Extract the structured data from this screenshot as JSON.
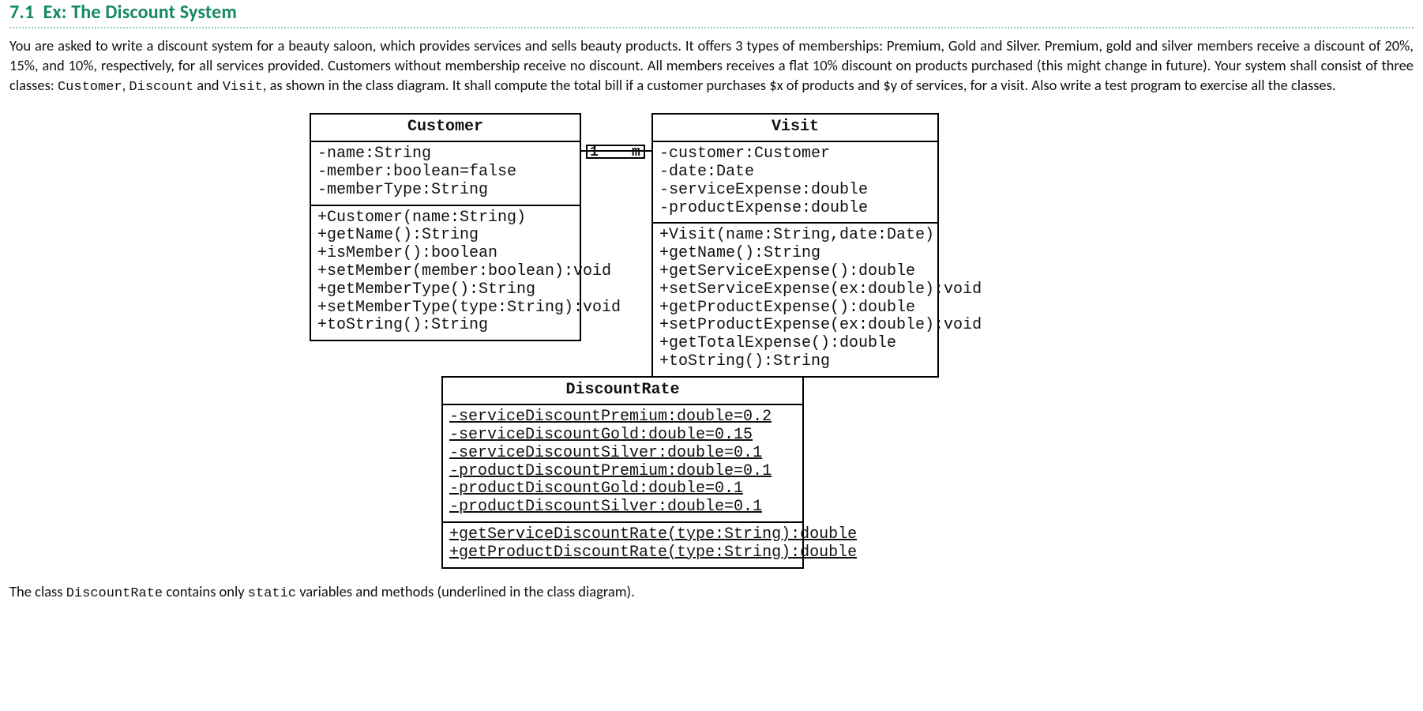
{
  "section": {
    "num": "7.1",
    "prefix": "Ex:",
    "title": "The Discount System"
  },
  "body": {
    "p1a": "You are asked to write a discount system for a beauty saloon, which provides services and sells beauty products. It offers 3 types of memberships: Premium, Gold and Silver. Premium, gold and silver members receive a discount of 20%, 15%, and 10%, respectively, for all services provided. Customers without membership receive no discount. All members receives a flat 10% discount on products purchased (this might change in future). Your system shall consist of three classes: ",
    "code1": "Customer",
    "sep1": ", ",
    "code2": "Discount",
    "mid": " and ",
    "code3": "Visit",
    "p1b": ", as shown in the class diagram. It shall compute the total bill if a customer purchases $x of products and $y of services, for a visit. Also write a test program to exercise all the classes."
  },
  "assoc": {
    "left": "1",
    "right": "m"
  },
  "classes": {
    "customer": {
      "name": "Customer",
      "attrs": [
        "-name:String",
        "-member:boolean=false",
        "-memberType:String"
      ],
      "ops": [
        "+Customer(name:String)",
        "+getName():String",
        "+isMember():boolean",
        "+setMember(member:boolean):void",
        "+getMemberType():String",
        "+setMemberType(type:String):void",
        "+toString():String"
      ]
    },
    "visit": {
      "name": "Visit",
      "attrs": [
        "-customer:Customer",
        "-date:Date",
        "-serviceExpense:double",
        "-productExpense:double"
      ],
      "ops": [
        "+Visit(name:String,date:Date)",
        "+getName():String",
        "+getServiceExpense():double",
        "+setServiceExpense(ex:double):void",
        "+getProductExpense():double",
        "+setProductExpense(ex:double):void",
        "+getTotalExpense():double",
        "+toString():String"
      ]
    },
    "discount": {
      "name": "DiscountRate",
      "attrs": [
        {
          "t": "-serviceDiscountPremium:double=0.2",
          "s": true
        },
        {
          "t": "-serviceDiscountGold:double=0.15",
          "s": true
        },
        {
          "t": "-serviceDiscountSilver:double=0.1",
          "s": true
        },
        {
          "t": "-productDiscountPremium:double=0.1",
          "s": true
        },
        {
          "t": "-productDiscountGold:double=0.1",
          "s": true
        },
        {
          "t": "-productDiscountSilver:double=0.1",
          "s": true
        }
      ],
      "ops": [
        {
          "t": "+getServiceDiscountRate(type:String):double",
          "s": true
        },
        {
          "t": "+getProductDiscountRate(type:String):double",
          "s": true
        }
      ]
    }
  },
  "closing": {
    "a": "The class ",
    "code1": "DiscountRate",
    "b": " contains only ",
    "code2": "static",
    "c": " variables and methods (underlined in the class diagram)."
  }
}
